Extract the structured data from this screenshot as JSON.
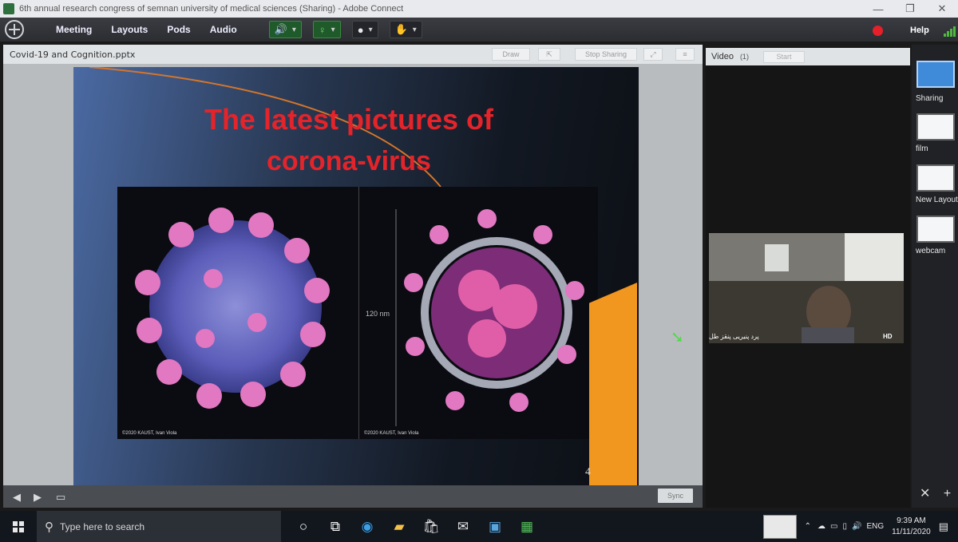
{
  "window": {
    "title": "6th annual research congress of semnan university of medical sciences (Sharing) - Adobe Connect",
    "controls": [
      "—",
      "❐",
      "✕"
    ]
  },
  "menu": {
    "items": [
      "Meeting",
      "Layouts",
      "Pods",
      "Audio"
    ],
    "help": "Help",
    "record_color": "#e5202a"
  },
  "share_pod": {
    "title": "Covid-19 and Cognition.pptx",
    "buttons": [
      "Draw",
      "Stop Sharing"
    ],
    "sync_label": "Sync",
    "slide": {
      "title_line1": "The latest pictures of",
      "title_line2": "corona-virus",
      "title_color": "#e4242a",
      "image_left_credit": "©2020 KAUST, Ivan Viola",
      "image_right_credit": "©2020 KAUST, Ivan Viola",
      "scale_label": "120 nm",
      "page_number": "4"
    }
  },
  "video_pod": {
    "title": "Video",
    "count": "(1)",
    "start_label": "Start",
    "participant_name": "پرد پنیریی پنقز طل",
    "quality": "HD"
  },
  "layouts_panel": {
    "items": [
      {
        "label": "Sharing",
        "active": true
      },
      {
        "label": "film",
        "active": false
      },
      {
        "label": "New Layout",
        "active": false
      },
      {
        "label": "webcam",
        "active": false
      }
    ]
  },
  "taskbar": {
    "search_placeholder": "Type here to search",
    "language": "ENG",
    "time": "9:39 AM",
    "date": "11/11/2020"
  }
}
